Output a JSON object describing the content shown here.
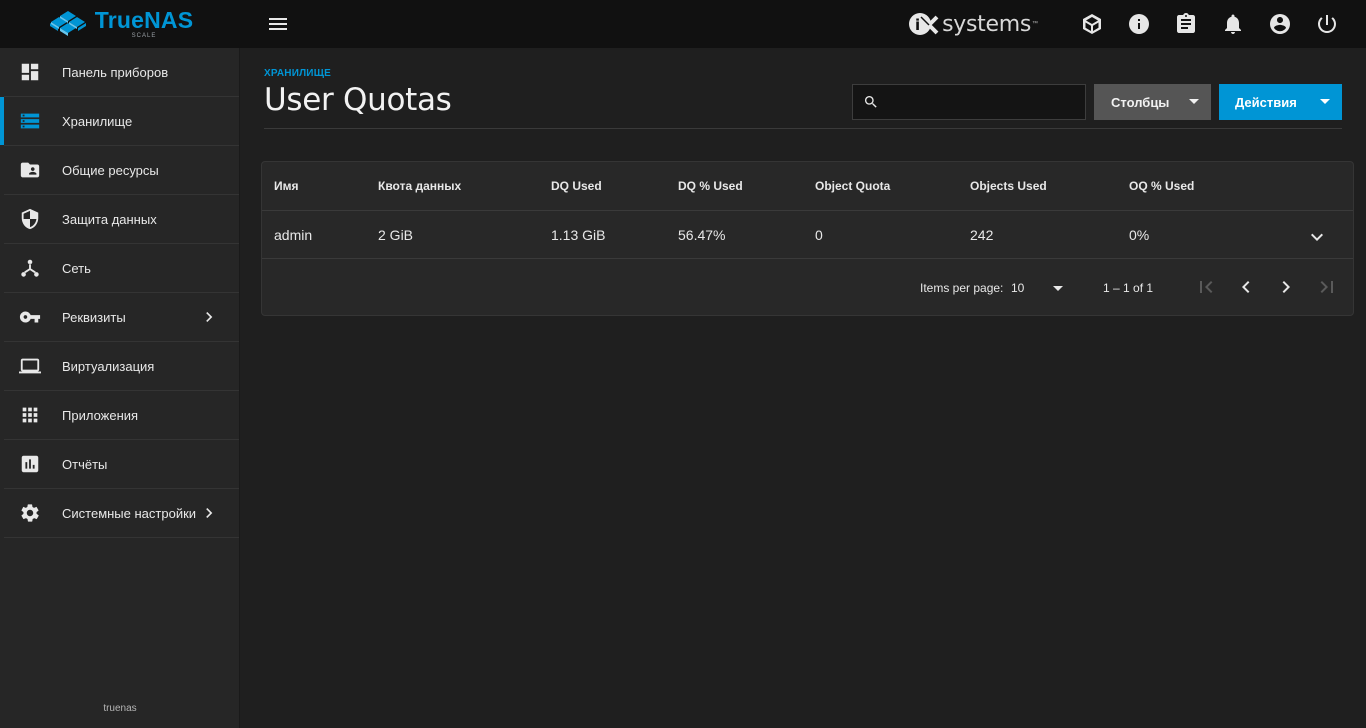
{
  "brand": {
    "name": "TrueNAS",
    "sub": "SCALE"
  },
  "topbar": {
    "vendor_text": "systems",
    "vendor_tm": "™",
    "icons": [
      "truecommand-icon",
      "info-icon",
      "clipboard-icon",
      "bell-icon",
      "account-icon",
      "power-icon"
    ]
  },
  "sidebar": {
    "items": [
      {
        "label": "Панель приборов",
        "icon": "dashboard-icon"
      },
      {
        "label": "Хранилище",
        "icon": "storage-icon",
        "active": true
      },
      {
        "label": "Общие ресурсы",
        "icon": "shares-icon"
      },
      {
        "label": "Защита данных",
        "icon": "shield-icon"
      },
      {
        "label": "Сеть",
        "icon": "network-icon"
      },
      {
        "label": "Реквизиты",
        "icon": "key-icon",
        "has_children": true
      },
      {
        "label": "Виртуализация",
        "icon": "laptop-icon"
      },
      {
        "label": "Приложения",
        "icon": "apps-grid-icon"
      },
      {
        "label": "Отчёты",
        "icon": "reports-icon"
      },
      {
        "label": "Системные настройки",
        "icon": "gear-icon",
        "has_children": true
      }
    ],
    "hostname": "truenas"
  },
  "page": {
    "breadcrumb": "ХРАНИЛИЩЕ",
    "title": "User Quotas",
    "search_placeholder": "",
    "columns_button": "Столбцы",
    "actions_button": "Действия"
  },
  "table": {
    "headers": [
      "Имя",
      "Квота данных",
      "DQ Used",
      "DQ % Used",
      "Object Quota",
      "Objects Used",
      "OQ % Used"
    ],
    "rows": [
      [
        "admin",
        "2 GiB",
        "1.13 GiB",
        "56.47%",
        "0",
        "242",
        "0%"
      ]
    ]
  },
  "paginator": {
    "items_per_page_label": "Items per page:",
    "page_size": "10",
    "range_label": "1 – 1 of 1"
  },
  "colors": {
    "accent": "#0095d5",
    "topbar": "#111111",
    "sidebar": "#262626",
    "background": "#1f1f1f"
  }
}
